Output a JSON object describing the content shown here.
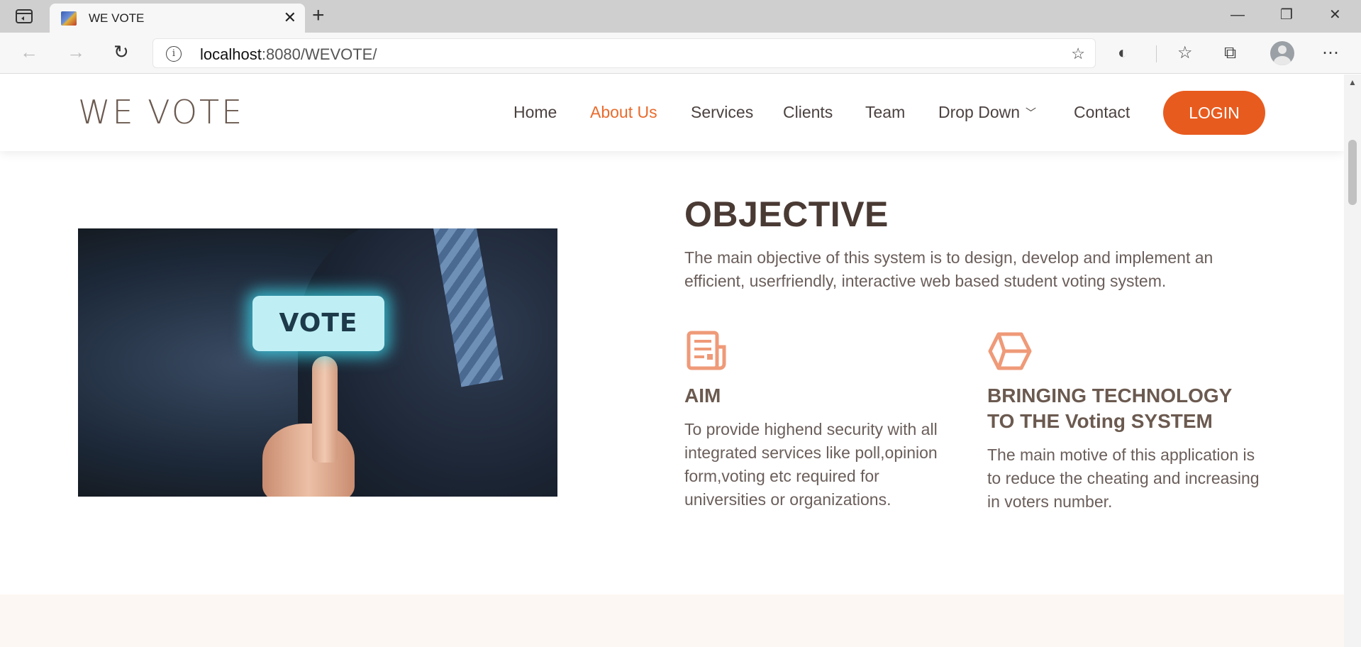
{
  "browser": {
    "tab_title": "WE VOTE",
    "url_host": "localhost",
    "url_rest": ":8080/WEVOTE/"
  },
  "site": {
    "logo": "WE VOTE",
    "nav": [
      {
        "label": "Home",
        "active": false
      },
      {
        "label": "About Us",
        "active": true
      },
      {
        "label": "Services",
        "active": false
      },
      {
        "label": "Clients",
        "active": false
      },
      {
        "label": "Team",
        "active": false
      },
      {
        "label": "Drop Down",
        "active": false
      },
      {
        "label": "Contact",
        "active": false
      }
    ],
    "login_label": "LOGIN",
    "accent_color": "#e85b1e"
  },
  "hero_image": {
    "button_text": "VOTE"
  },
  "objective": {
    "title": "OBJECTIVE",
    "text": "The main objective of this system is to design, develop and implement an efficient, userfriendly, interactive web based student voting system."
  },
  "features": [
    {
      "icon": "newspaper-icon",
      "title": "AIM",
      "text": "To provide highend security with all integrated services like poll,opinion form,voting etc required for universities or organizations."
    },
    {
      "icon": "cube-icon",
      "title": "BRINGING TECHNOLOGY TO THE Voting SYSTEM",
      "text": "The main motive of this application is to reduce the cheating and increasing in voters number."
    }
  ]
}
